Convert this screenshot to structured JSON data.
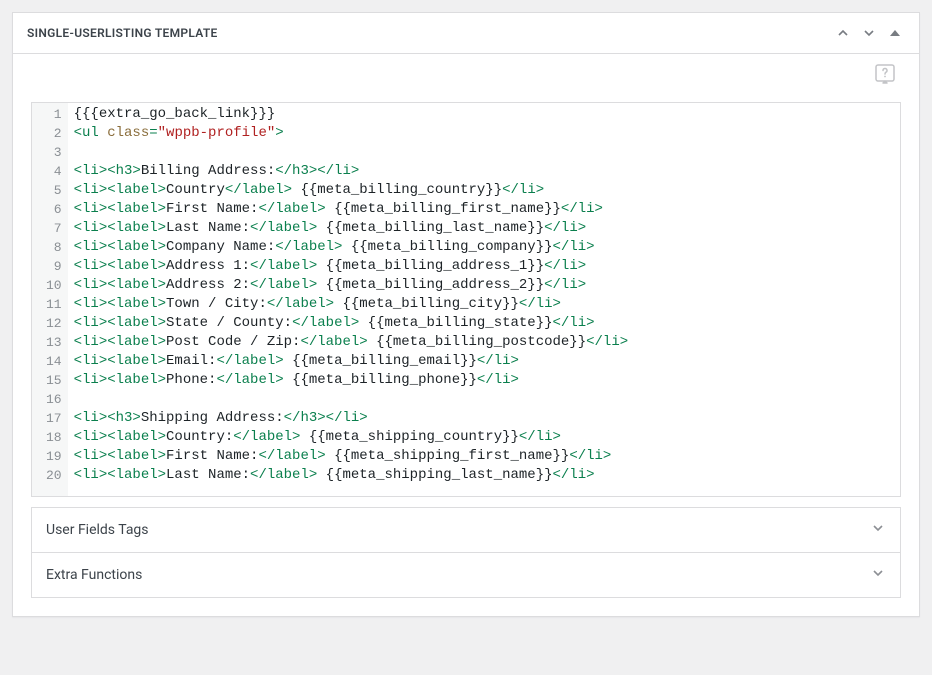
{
  "header": {
    "title": "SINGLE-USERLISTING TEMPLATE"
  },
  "accordions": {
    "user_fields": "User Fields Tags",
    "extra_functions": "Extra Functions"
  },
  "editor": {
    "lines": [
      [
        {
          "c": "txt",
          "t": "{{{extra_go_back_link}}}"
        }
      ],
      [
        {
          "c": "tag",
          "t": "<ul "
        },
        {
          "c": "attr",
          "t": "class"
        },
        {
          "c": "tag",
          "t": "="
        },
        {
          "c": "str",
          "t": "\"wppb-profile\""
        },
        {
          "c": "tag",
          "t": ">"
        }
      ],
      [],
      [
        {
          "c": "tag",
          "t": "<li><h3>"
        },
        {
          "c": "txt",
          "t": "Billing Address:"
        },
        {
          "c": "tag",
          "t": "</h3></li>"
        }
      ],
      [
        {
          "c": "tag",
          "t": "<li><label>"
        },
        {
          "c": "txt",
          "t": "Country"
        },
        {
          "c": "tag",
          "t": "</label>"
        },
        {
          "c": "txt",
          "t": " {{meta_billing_country}}"
        },
        {
          "c": "tag",
          "t": "</li>"
        }
      ],
      [
        {
          "c": "tag",
          "t": "<li><label>"
        },
        {
          "c": "txt",
          "t": "First Name:"
        },
        {
          "c": "tag",
          "t": "</label>"
        },
        {
          "c": "txt",
          "t": " {{meta_billing_first_name}}"
        },
        {
          "c": "tag",
          "t": "</li>"
        }
      ],
      [
        {
          "c": "tag",
          "t": "<li><label>"
        },
        {
          "c": "txt",
          "t": "Last Name:"
        },
        {
          "c": "tag",
          "t": "</label>"
        },
        {
          "c": "txt",
          "t": " {{meta_billing_last_name}}"
        },
        {
          "c": "tag",
          "t": "</li>"
        }
      ],
      [
        {
          "c": "tag",
          "t": "<li><label>"
        },
        {
          "c": "txt",
          "t": "Company Name:"
        },
        {
          "c": "tag",
          "t": "</label>"
        },
        {
          "c": "txt",
          "t": " {{meta_billing_company}}"
        },
        {
          "c": "tag",
          "t": "</li>"
        }
      ],
      [
        {
          "c": "tag",
          "t": "<li><label>"
        },
        {
          "c": "txt",
          "t": "Address 1:"
        },
        {
          "c": "tag",
          "t": "</label>"
        },
        {
          "c": "txt",
          "t": " {{meta_billing_address_1}}"
        },
        {
          "c": "tag",
          "t": "</li>"
        }
      ],
      [
        {
          "c": "tag",
          "t": "<li><label>"
        },
        {
          "c": "txt",
          "t": "Address 2:"
        },
        {
          "c": "tag",
          "t": "</label>"
        },
        {
          "c": "txt",
          "t": " {{meta_billing_address_2}}"
        },
        {
          "c": "tag",
          "t": "</li>"
        }
      ],
      [
        {
          "c": "tag",
          "t": "<li><label>"
        },
        {
          "c": "txt",
          "t": "Town / City:"
        },
        {
          "c": "tag",
          "t": "</label>"
        },
        {
          "c": "txt",
          "t": " {{meta_billing_city}}"
        },
        {
          "c": "tag",
          "t": "</li>"
        }
      ],
      [
        {
          "c": "tag",
          "t": "<li><label>"
        },
        {
          "c": "txt",
          "t": "State / County:"
        },
        {
          "c": "tag",
          "t": "</label>"
        },
        {
          "c": "txt",
          "t": " {{meta_billing_state}}"
        },
        {
          "c": "tag",
          "t": "</li>"
        }
      ],
      [
        {
          "c": "tag",
          "t": "<li><label>"
        },
        {
          "c": "txt",
          "t": "Post Code / Zip:"
        },
        {
          "c": "tag",
          "t": "</label>"
        },
        {
          "c": "txt",
          "t": " {{meta_billing_postcode}}"
        },
        {
          "c": "tag",
          "t": "</li>"
        }
      ],
      [
        {
          "c": "tag",
          "t": "<li><label>"
        },
        {
          "c": "txt",
          "t": "Email:"
        },
        {
          "c": "tag",
          "t": "</label>"
        },
        {
          "c": "txt",
          "t": " {{meta_billing_email}}"
        },
        {
          "c": "tag",
          "t": "</li>"
        }
      ],
      [
        {
          "c": "tag",
          "t": "<li><label>"
        },
        {
          "c": "txt",
          "t": "Phone:"
        },
        {
          "c": "tag",
          "t": "</label>"
        },
        {
          "c": "txt",
          "t": " {{meta_billing_phone}}"
        },
        {
          "c": "tag",
          "t": "</li>"
        }
      ],
      [],
      [
        {
          "c": "tag",
          "t": "<li><h3>"
        },
        {
          "c": "txt",
          "t": "Shipping Address:"
        },
        {
          "c": "tag",
          "t": "</h3></li>"
        }
      ],
      [
        {
          "c": "tag",
          "t": "<li><label>"
        },
        {
          "c": "txt",
          "t": "Country:"
        },
        {
          "c": "tag",
          "t": "</label>"
        },
        {
          "c": "txt",
          "t": " {{meta_shipping_country}}"
        },
        {
          "c": "tag",
          "t": "</li>"
        }
      ],
      [
        {
          "c": "tag",
          "t": "<li><label>"
        },
        {
          "c": "txt",
          "t": "First Name:"
        },
        {
          "c": "tag",
          "t": "</label>"
        },
        {
          "c": "txt",
          "t": " {{meta_shipping_first_name}}"
        },
        {
          "c": "tag",
          "t": "</li>"
        }
      ],
      [
        {
          "c": "tag",
          "t": "<li><label>"
        },
        {
          "c": "txt",
          "t": "Last Name:"
        },
        {
          "c": "tag",
          "t": "</label>"
        },
        {
          "c": "txt",
          "t": " {{meta_shipping_last_name}}"
        },
        {
          "c": "tag",
          "t": "</li>"
        }
      ]
    ]
  }
}
